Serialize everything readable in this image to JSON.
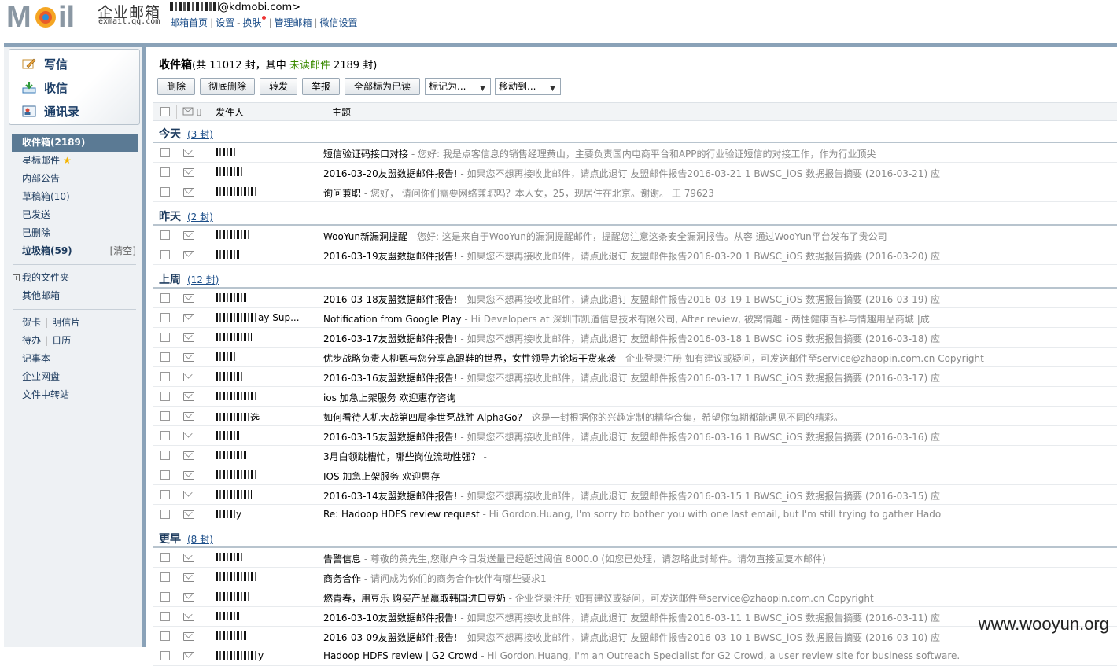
{
  "header": {
    "logo_cn": "企业邮箱",
    "logo_en": "exmail.qq.com",
    "account_suffix": "@kdmobi.com>",
    "links": [
      "邮箱首页",
      "设置",
      "换肤",
      "管理邮箱",
      "微信设置"
    ]
  },
  "sidebar": {
    "compose": "写信",
    "inbox": "收信",
    "contacts": "通讯录",
    "folders": {
      "inbox": "收件箱(2189)",
      "starred": "星标邮件",
      "notice": "内部公告",
      "drafts": "草稿箱(10)",
      "sent": "已发送",
      "deleted": "已删除",
      "spam": "垃圾箱(59)",
      "spam_clear": "[清空]",
      "my_folders": "我的文件夹",
      "other": "其他邮箱",
      "card": "贺卡",
      "postcard": "明信片",
      "todo": "待办",
      "calendar": "日历",
      "notes": "记事本",
      "disk": "企业网盘",
      "transfer": "文件中转站"
    }
  },
  "main": {
    "title": "收件箱",
    "title_count_pre": "(共 11012 封，其中 ",
    "title_unread_label": "未读邮件",
    "title_count_post": " 2189 封)",
    "toolbar": {
      "delete": "删除",
      "purge": "彻底删除",
      "forward": "转发",
      "report": "举报",
      "mark_all_read": "全部标为已读",
      "mark_as": "标记为...",
      "move_to": "移动到..."
    },
    "columns": {
      "sender": "发件人",
      "subject": "主题"
    },
    "groups": [
      {
        "title": "今天",
        "count": "(3 封)",
        "rows": [
          {
            "subject": "短信验证码接口对接",
            "preview": " - 您好:  我是点客信息的销售经理黄山，主要负责国内电商平台和APP的行业验证短信的对接工作，作为行业顶尖"
          },
          {
            "subject": "2016-03-20友盟数据邮件报告!",
            "preview": " - 如果您不想再接收此邮件，请点此退订 友盟邮件报告2016-03-21 1 BWSC_iOS 数据报告摘要 (2016-03-21) 应"
          },
          {
            "subject": "询问兼职",
            "preview": " - 您好，  请问你们需要网络兼职吗？本人女，25，现居住在北京。谢谢。  王  79623"
          }
        ]
      },
      {
        "title": "昨天",
        "count": "(2 封)",
        "rows": [
          {
            "subject": "WooYun新漏洞提醒",
            "preview": " - 您好:  这是来自于WooYun的漏洞提醒邮件，提醒您注意这条安全漏洞报告。从容 通过WooYun平台发布了贵公司"
          },
          {
            "subject": "2016-03-19友盟数据邮件报告!",
            "preview": " - 如果您不想再接收此邮件，请点此退订 友盟邮件报告2016-03-20 1 BWSC_iOS 数据报告摘要 (2016-03-20) 应"
          }
        ]
      },
      {
        "title": "上周",
        "count": "(12 封)",
        "rows": [
          {
            "subject": "2016-03-18友盟数据邮件报告!",
            "preview": " - 如果您不想再接收此邮件，请点此退订 友盟邮件报告2016-03-19 1 BWSC_iOS 数据报告摘要 (2016-03-19) 应"
          },
          {
            "sender": "ay Sup...",
            "subject": "Notification from Google Play",
            "preview": " - Hi Developers at 深圳市凯道信息技术有限公司, After review, 被窝情趣 - 两性健康百科与情趣用品商城 |成"
          },
          {
            "subject": "2016-03-17友盟数据邮件报告!",
            "preview": " - 如果您不想再接收此邮件，请点此退订 友盟邮件报告2016-03-18 1 BWSC_iOS 数据报告摘要 (2016-03-18) 应"
          },
          {
            "subject": "优步战略负责人柳甄与您分享高跟鞋的世界，女性领导力论坛干货来袭",
            "preview": " -  企业登录注册 如有建议或疑问，可发送邮件至service@zhaopin.com.cn Copyright"
          },
          {
            "subject": "2016-03-16友盟数据邮件报告!",
            "preview": " - 如果您不想再接收此邮件，请点此退订 友盟邮件报告2016-03-17 1 BWSC_iOS 数据报告摘要 (2016-03-17) 应"
          },
          {
            "subject": "ios 加急上架服务 欢迎惠存咨询",
            "preview": ""
          },
          {
            "sender": "选",
            "subject": "如何看待人机大战第四局李世乭战胜 AlphaGo?",
            "preview": " - 这是一封根据你的兴趣定制的精华合集，希望你每期都能遇见不同的精彩。"
          },
          {
            "subject": "2016-03-15友盟数据邮件报告!",
            "preview": " - 如果您不想再接收此邮件，请点此退订 友盟邮件报告2016-03-16 1 BWSC_iOS 数据报告摘要 (2016-03-16) 应"
          },
          {
            "subject": "3月白领跳槽忙，哪些岗位流动性强？",
            "preview": " -"
          },
          {
            "subject": "IOS 加急上架服务  欢迎惠存",
            "preview": ""
          },
          {
            "subject": "2016-03-14友盟数据邮件报告!",
            "preview": " - 如果您不想再接收此邮件，请点此退订 友盟邮件报告2016-03-15 1 BWSC_iOS 数据报告摘要 (2016-03-15) 应"
          },
          {
            "sender": "y",
            "subject": "Re: Hadoop HDFS review request",
            "preview": " - Hi Gordon.Huang, I'm sorry to bother you with one last email, but I'm still trying to gather Hado"
          }
        ]
      },
      {
        "title": "更早",
        "count": "(8 封)",
        "rows": [
          {
            "subject": "告警信息",
            "preview": " - 尊敬的黄先生,您账户今日发送量已经超过阈值 8000.0 (如您已处理，请忽略此封邮件。请勿直接回复本邮件)"
          },
          {
            "subject": "商务合作",
            "preview": " - 请问成为你们的商务合作伙伴有哪些要求1"
          },
          {
            "subject": "燃青春，用豆乐 购买产品赢取韩国进口豆奶",
            "preview": " -  企业登录注册 如有建议或疑问，可发送邮件至service@zhaopin.com.cn Copyright"
          },
          {
            "subject": "2016-03-10友盟数据邮件报告!",
            "preview": " - 如果您不想再接收此邮件，请点此退订 友盟邮件报告2016-03-11 1 BWSC_iOS 数据报告摘要 (2016-03-11) 应"
          },
          {
            "subject": "2016-03-09友盟数据邮件报告!",
            "preview": " - 如果您不想再接收此邮件，请点此退订 友盟邮件报告2016-03-10 1 BWSC_iOS 数据报告摘要 (2016-03-10) 应"
          },
          {
            "sender": "y",
            "subject": "Hadoop HDFS review | G2 Crowd",
            "preview": " - Hi Gordon.Huang, I'm an Outreach Specialist for G2 Crowd, a user review site for business software."
          }
        ]
      }
    ]
  },
  "watermark": "www.wooyun.org",
  "colors": {
    "accent": "#5b7a94",
    "frame": "#8aa2b8",
    "link": "#1d4f8a",
    "unread": "#3a8a00"
  }
}
